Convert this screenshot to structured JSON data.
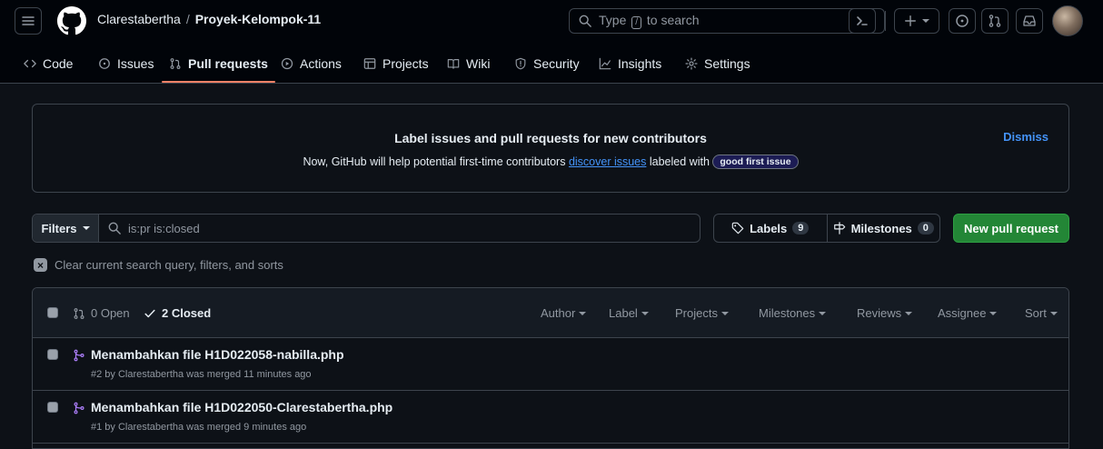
{
  "header": {
    "owner": "Clarestabertha",
    "separator": "/",
    "repo": "Proyek-Kelompok-11",
    "search_prefix": "Type",
    "search_key": "/",
    "search_suffix": "to search"
  },
  "nav": {
    "tabs": [
      {
        "label": "Code",
        "icon": "code-icon"
      },
      {
        "label": "Issues",
        "icon": "issue-icon"
      },
      {
        "label": "Pull requests",
        "icon": "pull-request-icon",
        "active": true
      },
      {
        "label": "Actions",
        "icon": "play-icon"
      },
      {
        "label": "Projects",
        "icon": "table-icon"
      },
      {
        "label": "Wiki",
        "icon": "book-icon"
      },
      {
        "label": "Security",
        "icon": "shield-icon"
      },
      {
        "label": "Insights",
        "icon": "graph-icon"
      },
      {
        "label": "Settings",
        "icon": "gear-icon"
      }
    ]
  },
  "banner": {
    "title": "Label issues and pull requests for new contributors",
    "text_before": "Now, GitHub will help potential first-time contributors",
    "link": "discover issues",
    "text_after": "labeled with",
    "pill": "good first issue",
    "dismiss": "Dismiss"
  },
  "filters": {
    "button": "Filters",
    "query": "is:pr is:closed",
    "labels": "Labels",
    "labels_count": "9",
    "milestones": "Milestones",
    "milestones_count": "0",
    "new_pr": "New pull request",
    "clear": "Clear current search query, filters, and sorts"
  },
  "list": {
    "open": "0 Open",
    "closed": "2 Closed",
    "columns": [
      "Author",
      "Label",
      "Projects",
      "Milestones",
      "Reviews",
      "Assignee",
      "Sort"
    ],
    "items": [
      {
        "title": "Menambahkan file H1D022058-nabilla.php",
        "meta": "#2 by Clarestabertha was merged 11 minutes ago"
      },
      {
        "title": "Menambahkan file H1D022050-Clarestabertha.php",
        "meta": "#1 by Clarestabertha was merged 9 minutes ago"
      }
    ]
  },
  "colors": {
    "accent_link": "#4493f8",
    "merged": "#ab7df8",
    "primary_button": "#238636",
    "active_tab_underline": "#f78166"
  }
}
